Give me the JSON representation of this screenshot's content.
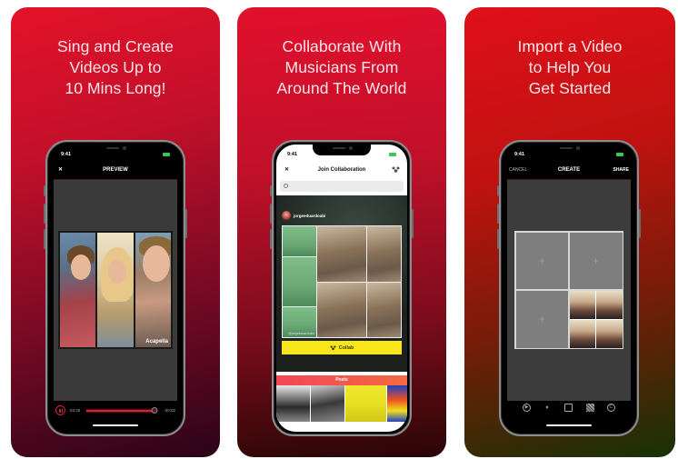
{
  "panels": [
    {
      "headline": [
        "Sing and Create",
        "Videos Up to",
        "10 Mins Long!"
      ],
      "phone": {
        "status_time": "9:41",
        "nav_left": "✕",
        "nav_title": "PREVIEW",
        "video_label": "Acapella",
        "playback": {
          "elapsed": "03:25",
          "remaining": "-00:02",
          "progress_fraction": 0.99,
          "state": "playing"
        }
      }
    },
    {
      "headline": [
        "Collaborate With",
        "Musicians From",
        "Around The World"
      ],
      "phone": {
        "status_time": "9:41",
        "nav_left": "✕",
        "nav_title": "Join Collaboration",
        "search_placeholder": "",
        "username": "jorgeeduardoabi",
        "watermark": "@jorgeeduardoabi",
        "collab_button": "Collab",
        "posts_header": "Posts"
      }
    },
    {
      "headline": [
        "Import a Video",
        "to Help You",
        "Get Started"
      ],
      "phone": {
        "status_time": "9:41",
        "nav_left": "CANCEL",
        "nav_title": "CREATE",
        "nav_right": "SHARE",
        "empty_slot_glyph": "+",
        "toolbar_icons": [
          "play-icon",
          "volume-icon",
          "layout-icon",
          "pattern-icon",
          "copyright-icon"
        ]
      }
    }
  ],
  "colors": {
    "accent_red": "#d22333",
    "collab_yellow": "#f6e61a",
    "battery_green": "#3cc654"
  }
}
